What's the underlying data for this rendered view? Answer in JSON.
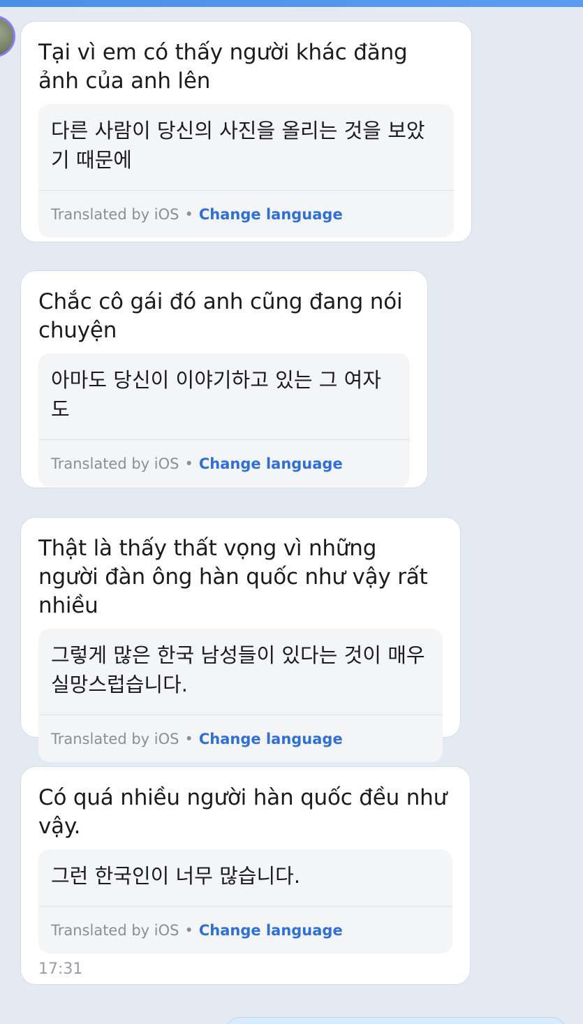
{
  "messages": [
    {
      "original": "Tại vì em có thấy người khác đăng ảnh của anh lên",
      "translation": "다른 사람이 당신의 사진을 올리는 것을 보았기 때문에",
      "translated_by": "Translated by iOS",
      "separator": "•",
      "change_language": "Change language"
    },
    {
      "original": "Chắc cô gái đó anh cũng đang nói chuyện",
      "translation": "아마도 당신이 이야기하고 있는 그 여자도",
      "translated_by": "Translated by iOS",
      "separator": "•",
      "change_language": "Change language"
    },
    {
      "original": "Thật là thấy thất vọng vì những người đàn ông hàn quốc như vậy rất nhiều",
      "translation": "그렇게 많은 한국 남성들이 있다는 것이 매우 실망스럽습니다.",
      "translated_by": "Translated by iOS",
      "separator": "•",
      "change_language": "Change language"
    },
    {
      "original": "Có quá nhiều người hàn quốc đều như vậy.",
      "translation": "그런 한국인이 너무 많습니다.",
      "translated_by": "Translated by iOS",
      "separator": "•",
      "change_language": "Change language",
      "time": "17:31"
    }
  ]
}
